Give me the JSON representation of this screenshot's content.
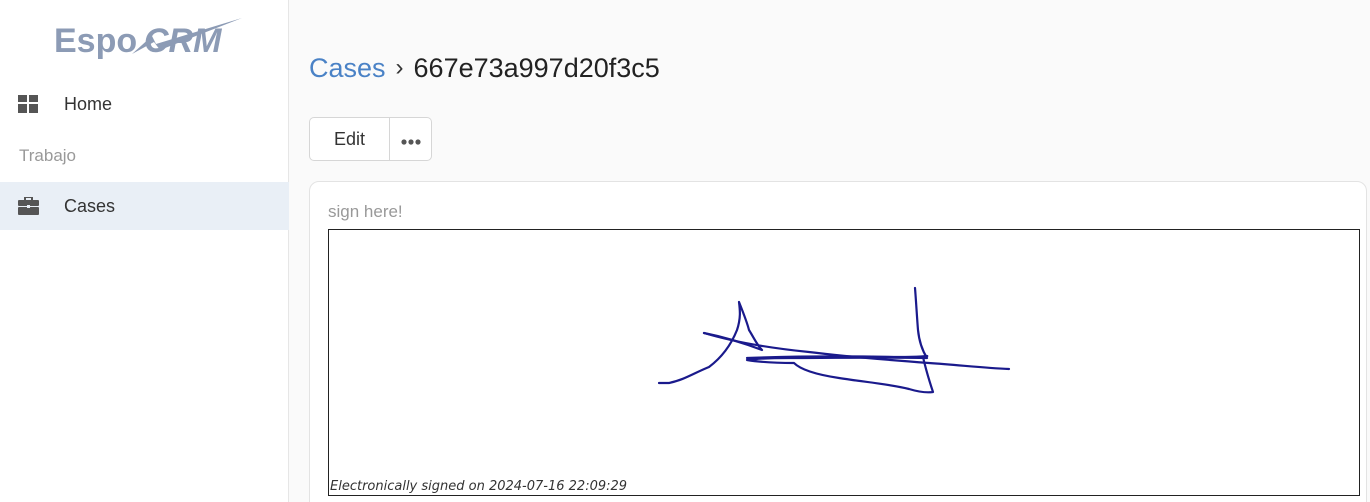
{
  "app": {
    "logo_text": "EspoCRM"
  },
  "sidebar": {
    "items": [
      {
        "label": "Home",
        "icon": "dashboard-grid-icon"
      },
      {
        "label": "Cases",
        "icon": "briefcase-icon",
        "active": true
      }
    ],
    "section_label": "Trabajo"
  },
  "breadcrumb": {
    "parent": "Cases",
    "separator": "›",
    "current": "667e73a997d20f3c5"
  },
  "actions": {
    "edit_label": "Edit",
    "more_label": "•••"
  },
  "record": {
    "field_label": "sign here!",
    "signed_note": "Electronically signed on 2024-07-16 22:09:29",
    "signature_stroke_color": "#1a1a8c"
  },
  "colors": {
    "link": "#4a82c6",
    "active_nav_bg": "#e9eff6"
  }
}
